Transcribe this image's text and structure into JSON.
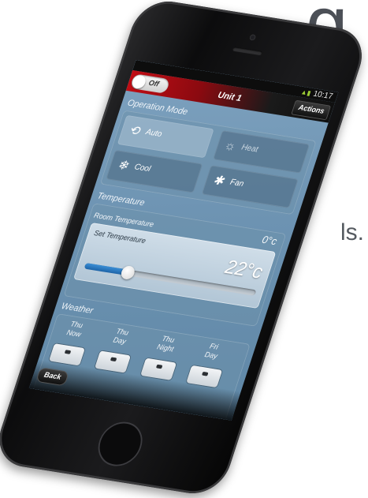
{
  "background": {
    "headline_fragment": "g",
    "body_fragment": "ls."
  },
  "status_bar": {
    "time": "10:17"
  },
  "header": {
    "power_toggle_label": "Off",
    "unit_title": "Unit 1",
    "actions_label": "Actions"
  },
  "operation_mode": {
    "title": "Operation Mode",
    "modes": [
      {
        "label": "Auto",
        "icon": "auto-cycle-icon",
        "active": true
      },
      {
        "label": "Heat",
        "icon": "sun-icon",
        "active": false
      },
      {
        "label": "Cool",
        "icon": "snowflake-icon",
        "active": false
      },
      {
        "label": "Fan",
        "icon": "fan-icon",
        "active": false
      }
    ]
  },
  "temperature": {
    "title": "Temperature",
    "room_label": "Room Temperature",
    "room_value": "0°c",
    "set_label": "Set Temperature",
    "set_value": "22°c",
    "slider_fraction": 0.25
  },
  "weather": {
    "title": "Weather",
    "forecast": [
      {
        "line1": "Thu",
        "line2": "Now"
      },
      {
        "line1": "Thu",
        "line2": "Day"
      },
      {
        "line1": "Thu",
        "line2": "Night"
      },
      {
        "line1": "Fri",
        "line2": "Day"
      }
    ]
  },
  "footer": {
    "back_label": "Back"
  },
  "colors": {
    "header_red": "#c00d14",
    "slider_blue": "#2b7cc4",
    "screen_blue": "#6d93b2"
  }
}
